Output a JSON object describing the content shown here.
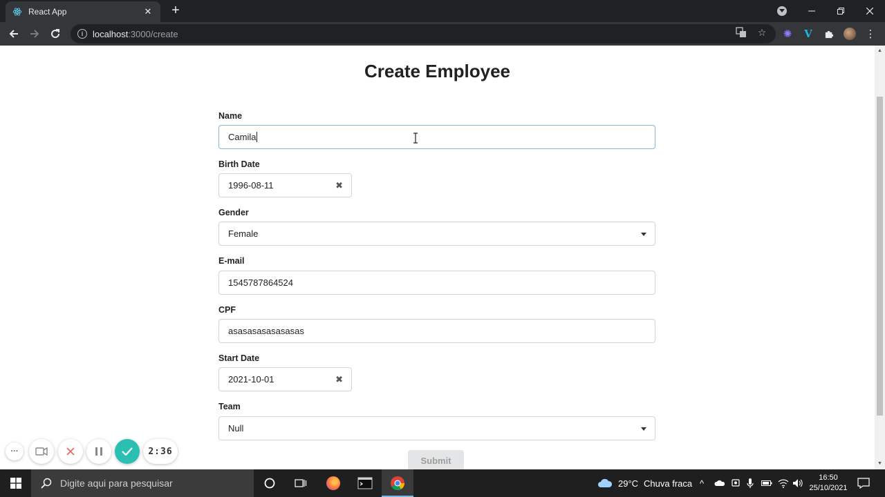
{
  "browser": {
    "tab_title": "React App",
    "url_host": "localhost",
    "url_path": ":3000/create"
  },
  "page": {
    "title": "Create Employee",
    "fields": {
      "name": {
        "label": "Name",
        "value": "Camila"
      },
      "birth_date": {
        "label": "Birth Date",
        "value": "1996-08-11"
      },
      "gender": {
        "label": "Gender",
        "value": "Female"
      },
      "email": {
        "label": "E-mail",
        "value": "1545787864524"
      },
      "cpf": {
        "label": "CPF",
        "value": "asasasasasasasas"
      },
      "start_date": {
        "label": "Start Date",
        "value": "2021-10-01"
      },
      "team": {
        "label": "Team",
        "value": "Null"
      }
    },
    "submit_label": "Submit"
  },
  "recorder": {
    "elapsed": "2:36",
    "accent": "#2bbfb3"
  },
  "taskbar": {
    "search_placeholder": "Digite aqui para pesquisar",
    "weather_temp": "29°C",
    "weather_desc": "Chuva fraca",
    "time": "16:50",
    "date": "25/10/2021"
  },
  "icons": [
    "react-icon",
    "close-icon",
    "plus-icon",
    "back-icon",
    "forward-icon",
    "reload-icon",
    "info-icon",
    "translate-icon",
    "star-icon",
    "extension-icon",
    "vimeo-icon",
    "puzzle-icon",
    "menu-icon",
    "windows-icon",
    "search-icon",
    "cortana-icon",
    "taskview-icon",
    "firefox-icon",
    "terminal-icon",
    "chrome-icon",
    "weather-icon"
  ]
}
